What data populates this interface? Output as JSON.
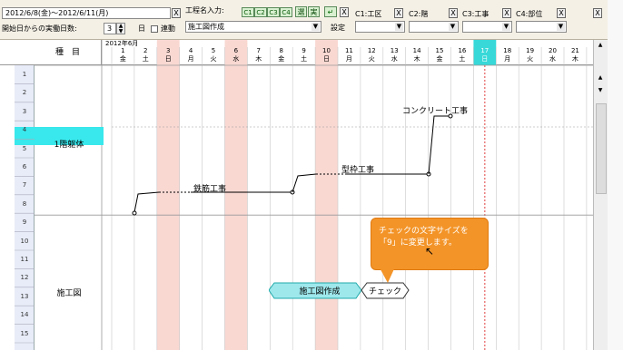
{
  "toolbar": {
    "period": "2012/6/8(金)～2012/6/11(月)",
    "actual_days_label": "開始日からの実働日数:",
    "actual_days_value": "3",
    "day_unit": "日",
    "link_label": "連動",
    "x_mark": "X",
    "process_input_label": "工程名入力:",
    "c_buttons": [
      "C1",
      "C2",
      "C3",
      "C4"
    ],
    "select_btn": "選",
    "actual_btn": "実",
    "process_value": "施工図作成",
    "setting_btn": "設定",
    "filters": [
      {
        "label": "C1:工区",
        "value": ""
      },
      {
        "label": "C2:階",
        "value": ""
      },
      {
        "label": "C3:工事",
        "value": ""
      },
      {
        "label": "C4:部位",
        "value": ""
      }
    ]
  },
  "chart": {
    "month_label": "2012年6月",
    "item_header": "種　目",
    "days": [
      {
        "d": "1",
        "w": "金"
      },
      {
        "d": "2",
        "w": "土"
      },
      {
        "d": "3",
        "w": "日"
      },
      {
        "d": "4",
        "w": "月"
      },
      {
        "d": "5",
        "w": "火"
      },
      {
        "d": "6",
        "w": "水"
      },
      {
        "d": "7",
        "w": "木"
      },
      {
        "d": "8",
        "w": "金"
      },
      {
        "d": "9",
        "w": "土"
      },
      {
        "d": "10",
        "w": "日"
      },
      {
        "d": "11",
        "w": "月"
      },
      {
        "d": "12",
        "w": "火"
      },
      {
        "d": "13",
        "w": "水"
      },
      {
        "d": "14",
        "w": "木"
      },
      {
        "d": "15",
        "w": "金"
      },
      {
        "d": "16",
        "w": "土"
      },
      {
        "d": "17",
        "w": "日"
      },
      {
        "d": "18",
        "w": "月"
      },
      {
        "d": "19",
        "w": "火"
      },
      {
        "d": "20",
        "w": "水"
      },
      {
        "d": "21",
        "w": "木"
      }
    ],
    "rows": [
      "1",
      "2",
      "3",
      "4",
      "5",
      "6",
      "7",
      "8",
      "9",
      "10",
      "11",
      "12",
      "13",
      "14",
      "15"
    ],
    "groups": [
      {
        "label": "1階躯体"
      },
      {
        "label": "施工図"
      }
    ],
    "tasks": {
      "rebar": "鉄筋工事",
      "formwork": "型枠工事",
      "concrete": "コンクリート工事",
      "drawing": "施工図作成",
      "check": "チェック"
    }
  },
  "balloon": {
    "line1": "チェックの文字サイズを",
    "line2": "「9」に変更します。"
  },
  "colors": {
    "holiday_band": "#f9d8d2",
    "today_band": "#38d8d8",
    "group_highlight": "#38e8ec",
    "balloon": "#f39428",
    "drawing_task": "#9ee8ec"
  }
}
